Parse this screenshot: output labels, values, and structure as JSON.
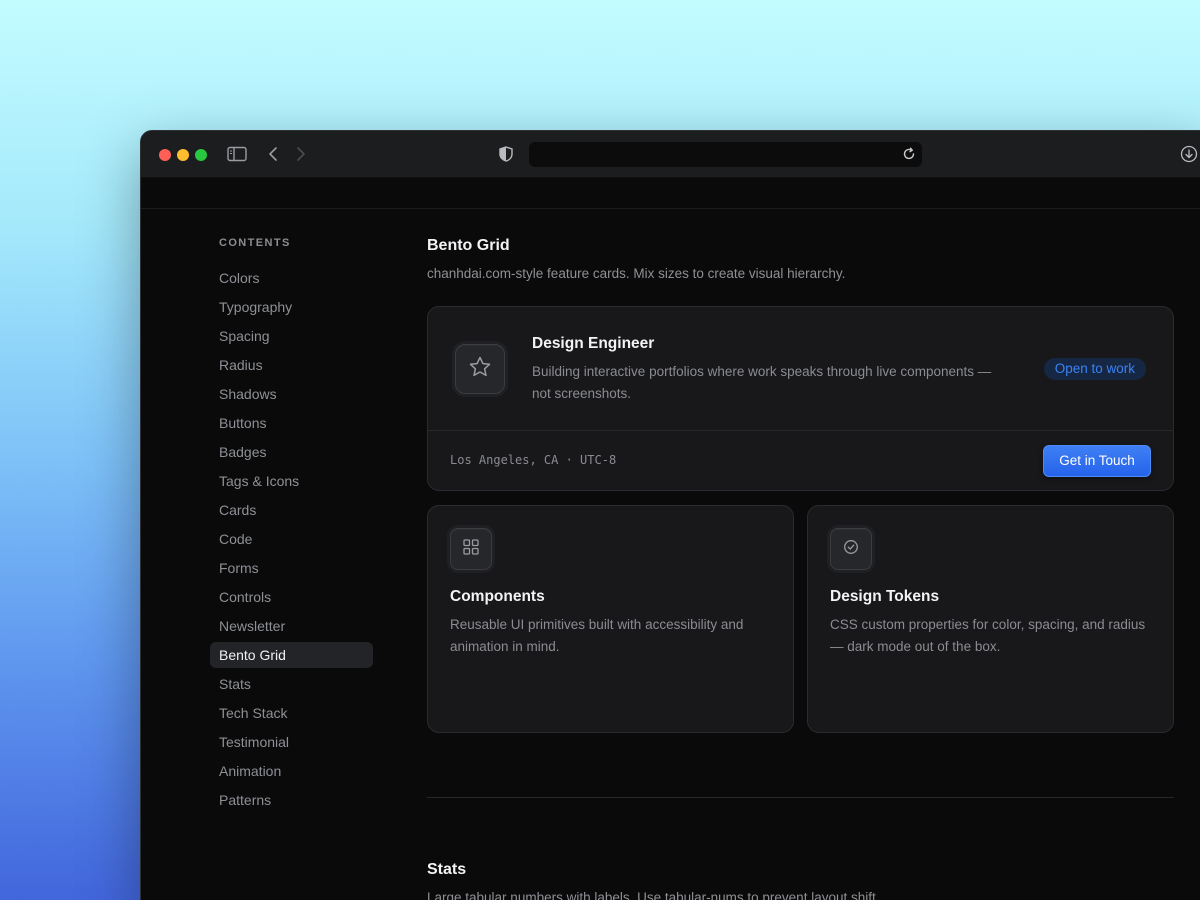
{
  "browser": {
    "traffic_lights": [
      "close",
      "minimize",
      "zoom"
    ],
    "url": ""
  },
  "sidebar": {
    "heading": "CONTENTS",
    "items": [
      {
        "label": "Colors",
        "active": false
      },
      {
        "label": "Typography",
        "active": false
      },
      {
        "label": "Spacing",
        "active": false
      },
      {
        "label": "Radius",
        "active": false
      },
      {
        "label": "Shadows",
        "active": false
      },
      {
        "label": "Buttons",
        "active": false
      },
      {
        "label": "Badges",
        "active": false
      },
      {
        "label": "Tags & Icons",
        "active": false
      },
      {
        "label": "Cards",
        "active": false
      },
      {
        "label": "Code",
        "active": false
      },
      {
        "label": "Forms",
        "active": false
      },
      {
        "label": "Controls",
        "active": false
      },
      {
        "label": "Newsletter",
        "active": false
      },
      {
        "label": "Bento Grid",
        "active": true
      },
      {
        "label": "Stats",
        "active": false
      },
      {
        "label": "Tech Stack",
        "active": false
      },
      {
        "label": "Testimonial",
        "active": false
      },
      {
        "label": "Animation",
        "active": false
      },
      {
        "label": "Patterns",
        "active": false
      }
    ]
  },
  "section": {
    "title": "Bento Grid",
    "subtitle": "chanhdai.com-style feature cards. Mix sizes to create visual hierarchy."
  },
  "hero_card": {
    "icon": "star-icon",
    "title": "Design Engineer",
    "description": "Building interactive portfolios where work speaks through live components — not screenshots.",
    "badge": "Open to work",
    "location": "Los Angeles, CA · UTC-8",
    "cta": "Get in Touch"
  },
  "feature_cards": [
    {
      "icon": "grid-icon",
      "title": "Components",
      "description": "Reusable UI primitives built with accessibility and animation in mind."
    },
    {
      "icon": "check-circle-icon",
      "title": "Design Tokens",
      "description": "CSS custom properties for color, spacing, and radius — dark mode out of the box."
    }
  ],
  "next_section": {
    "title": "Stats",
    "subtitle": "Large tabular numbers with labels. Use tabular-nums to prevent layout shift."
  },
  "colors": {
    "accent": "#2563eb",
    "badge_text": "#3b82f6",
    "background": "#0a0a0b",
    "card": "#18181b"
  }
}
